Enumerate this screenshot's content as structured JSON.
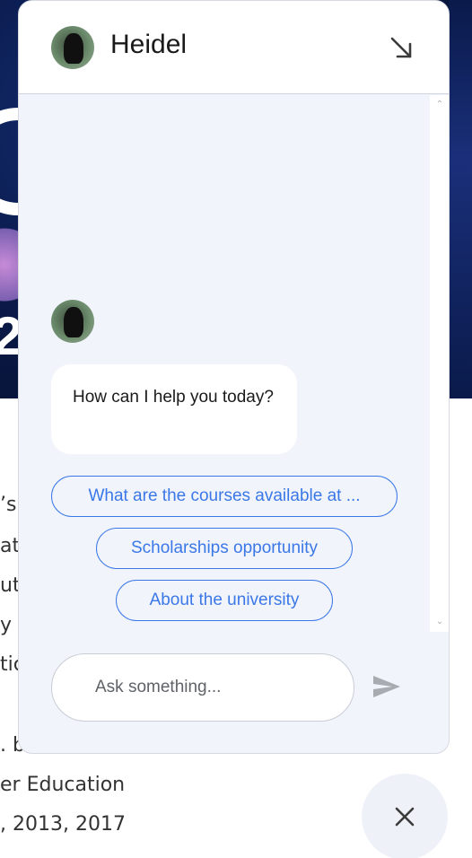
{
  "background": {
    "hero_fragment": "2",
    "text_lines": [
      "’s",
      "at",
      "ut",
      "y",
      "tic",
      ". be",
      "er Education",
      ", 2013, 2017"
    ]
  },
  "chat": {
    "bot_name": "Heidel",
    "greeting": "How can I help you today?",
    "suggestions": [
      "What are the courses available at ...",
      "Scholarships opportunity",
      "About the university"
    ],
    "input_placeholder": "Ask something...",
    "icons": {
      "minimize": "arrow-down-right-icon",
      "send": "send-icon",
      "close": "close-icon"
    },
    "colors": {
      "accent": "#3b78e7",
      "panel_bg": "#f1f4fb"
    }
  }
}
